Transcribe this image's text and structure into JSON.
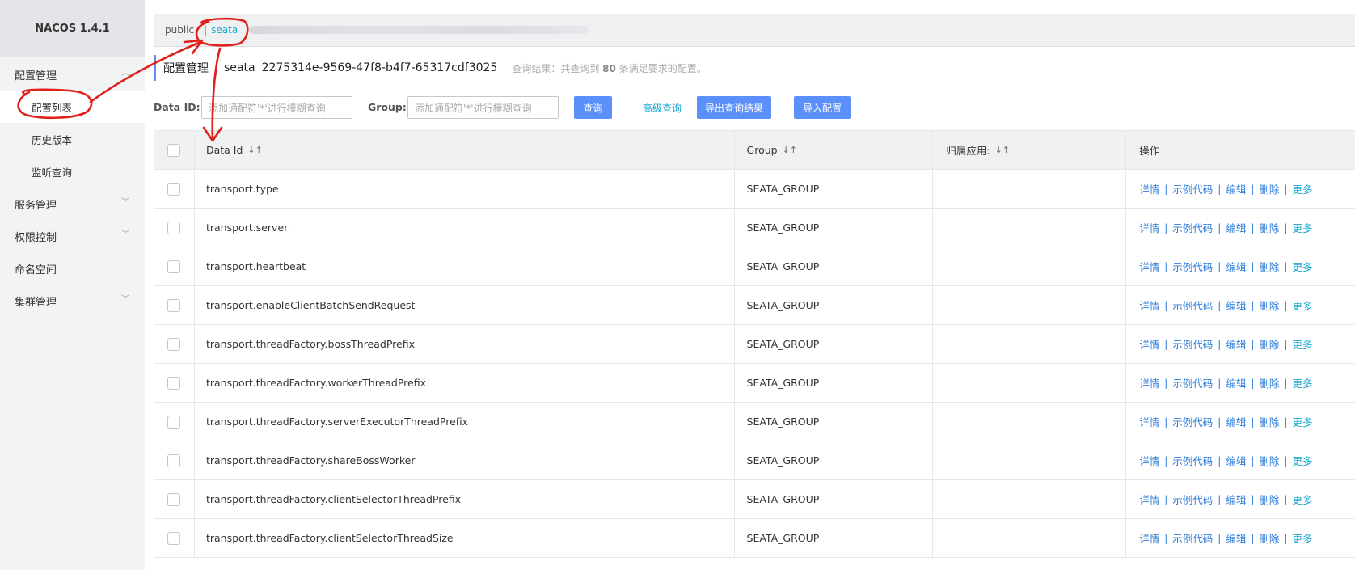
{
  "sidebar": {
    "brand": "NACOS 1.4.1",
    "groups": [
      {
        "label": "配置管理",
        "chevron": "chevron-up-icon",
        "items": [
          "配置列表",
          "历史版本",
          "监听查询"
        ]
      },
      {
        "label": "服务管理",
        "chevron": "chevron-down-icon"
      },
      {
        "label": "权限控制",
        "chevron": "chevron-down-icon"
      },
      {
        "label": "命名空间"
      },
      {
        "label": "集群管理",
        "chevron": "chevron-down-icon"
      }
    ]
  },
  "namespaces": {
    "items": [
      "public",
      "seata"
    ],
    "separator": "|",
    "active": "seata"
  },
  "title": {
    "section": "配置管理",
    "namespace_name": "seata",
    "namespace_id": "2275314e-9569-47f8-b4f7-65317cdf3025",
    "result_prefix": "查询结果：共查询到",
    "result_count": "80",
    "result_suffix": "条满足要求的配置。"
  },
  "search": {
    "data_id_label": "Data ID:",
    "data_id_placeholder": "添加通配符'*'进行模糊查询",
    "group_label": "Group:",
    "group_placeholder": "添加通配符'*'进行模糊查询",
    "query_button": "查询",
    "advanced_link": "高级查询",
    "export_button": "导出查询结果",
    "import_button": "导入配置"
  },
  "table": {
    "headers": {
      "data_id": "Data Id",
      "group": "Group",
      "app": "归属应用:",
      "ops": "操作"
    },
    "ops": {
      "detail": "详情",
      "sample": "示例代码",
      "edit": "编辑",
      "delete": "删除",
      "more": "更多",
      "sep": "|"
    },
    "rows": [
      {
        "data_id": "transport.type",
        "group": "SEATA_GROUP",
        "app": ""
      },
      {
        "data_id": "transport.server",
        "group": "SEATA_GROUP",
        "app": ""
      },
      {
        "data_id": "transport.heartbeat",
        "group": "SEATA_GROUP",
        "app": ""
      },
      {
        "data_id": "transport.enableClientBatchSendRequest",
        "group": "SEATA_GROUP",
        "app": ""
      },
      {
        "data_id": "transport.threadFactory.bossThreadPrefix",
        "group": "SEATA_GROUP",
        "app": ""
      },
      {
        "data_id": "transport.threadFactory.workerThreadPrefix",
        "group": "SEATA_GROUP",
        "app": ""
      },
      {
        "data_id": "transport.threadFactory.serverExecutorThreadPrefix",
        "group": "SEATA_GROUP",
        "app": ""
      },
      {
        "data_id": "transport.threadFactory.shareBossWorker",
        "group": "SEATA_GROUP",
        "app": ""
      },
      {
        "data_id": "transport.threadFactory.clientSelectorThreadPrefix",
        "group": "SEATA_GROUP",
        "app": ""
      },
      {
        "data_id": "transport.threadFactory.clientSelectorThreadSize",
        "group": "SEATA_GROUP",
        "app": ""
      }
    ]
  },
  "colors": {
    "primary": "#5b8ff9",
    "link": "#2f7dd8",
    "active_namespace": "#19aad3",
    "annotation": "#e0201b"
  }
}
